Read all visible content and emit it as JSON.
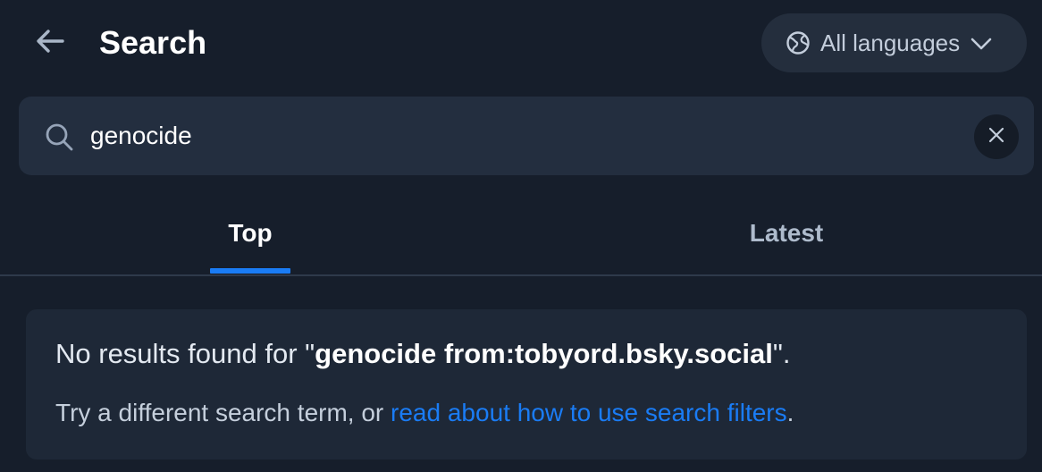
{
  "header": {
    "title": "Search",
    "back_icon": "arrow-left-icon",
    "language_button": {
      "label": "All languages",
      "icon": "globe-icon",
      "chevron_icon": "chevron-down-icon"
    }
  },
  "search": {
    "value": "genocide",
    "icon": "search-icon",
    "clear_icon": "close-icon"
  },
  "tabs": [
    {
      "label": "Top",
      "active": true
    },
    {
      "label": "Latest",
      "active": false
    }
  ],
  "results": {
    "no_results_prefix": "No results found for \"",
    "query": "genocide from:tobyord.bsky.social",
    "no_results_suffix": "\".",
    "hint_prefix": "Try a different search term, or ",
    "hint_link": "read about how to use search filters",
    "hint_suffix": "."
  },
  "colors": {
    "background": "#161e2b",
    "accent": "#1a7cf5",
    "surface": "#232e3f"
  }
}
